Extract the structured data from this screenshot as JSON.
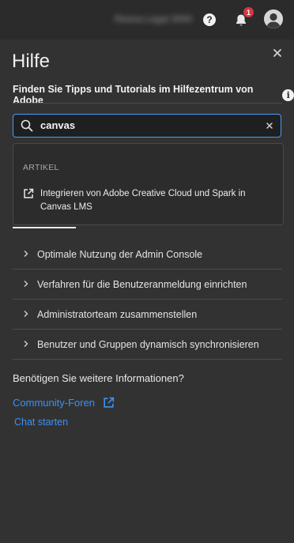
{
  "topbar": {
    "org_name": "Reena Legal 3000",
    "notification_count": "1"
  },
  "panel": {
    "title": "Hilfe",
    "subtitle": "Finden Sie Tipps und Tutorials im Hilfezentrum von Adobe",
    "search": {
      "value": "canvas"
    },
    "results": {
      "category": "ARTIKEL",
      "items": [
        {
          "label": "Integrieren von Adobe Creative Cloud und Spark in Canvas LMS"
        }
      ]
    },
    "accordion": [
      {
        "label": "Optimale Nutzung der Admin Console"
      },
      {
        "label": "Verfahren für die Benutzeranmeldung einrichten"
      },
      {
        "label": "Administratorteam zusammenstellen"
      },
      {
        "label": "Benutzer und Gruppen dynamisch synchronisieren"
      }
    ],
    "more_info": "Benötigen Sie weitere Informationen?",
    "community_link": "Community-Foren",
    "chat_link": "Chat starten"
  },
  "colors": {
    "accent": "#3b92f6",
    "focus_border": "#4b9cf5",
    "badge": "#d7373f",
    "background": "#323232"
  }
}
